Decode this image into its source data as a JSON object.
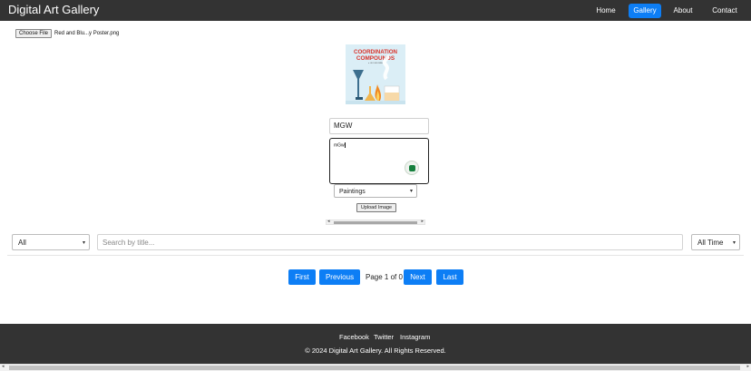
{
  "header": {
    "brand": "Digital Art Gallery",
    "nav": [
      {
        "label": "Home",
        "active": false
      },
      {
        "label": "Gallery",
        "active": true
      },
      {
        "label": "About",
        "active": false
      },
      {
        "label": "Contact",
        "active": false
      }
    ]
  },
  "upload": {
    "choose_label": "Choose File",
    "file_name": "Red and Blu...y Poster.png",
    "preview": {
      "line1": "COORDINATION",
      "line2": "COMPOUNDS",
      "caption": "● LEO HELLMAN"
    },
    "title_value": "MGW",
    "description_value": "mGw",
    "category_selected": "Paintings",
    "upload_label": "Upload Image"
  },
  "filters": {
    "category_selected": "All",
    "search_placeholder": "Search by title...",
    "time_selected": "All Time"
  },
  "pagination": {
    "first": "First",
    "previous": "Previous",
    "info": "Page 1 of 0",
    "next": "Next",
    "last": "Last"
  },
  "footer": {
    "links": [
      "Facebook",
      "Twitter",
      "Instagram"
    ],
    "copyright": "© 2024 Digital Art Gallery. All Rights Reserved."
  },
  "colors": {
    "accent": "#0d7ef5",
    "dark_bar": "#333333"
  }
}
